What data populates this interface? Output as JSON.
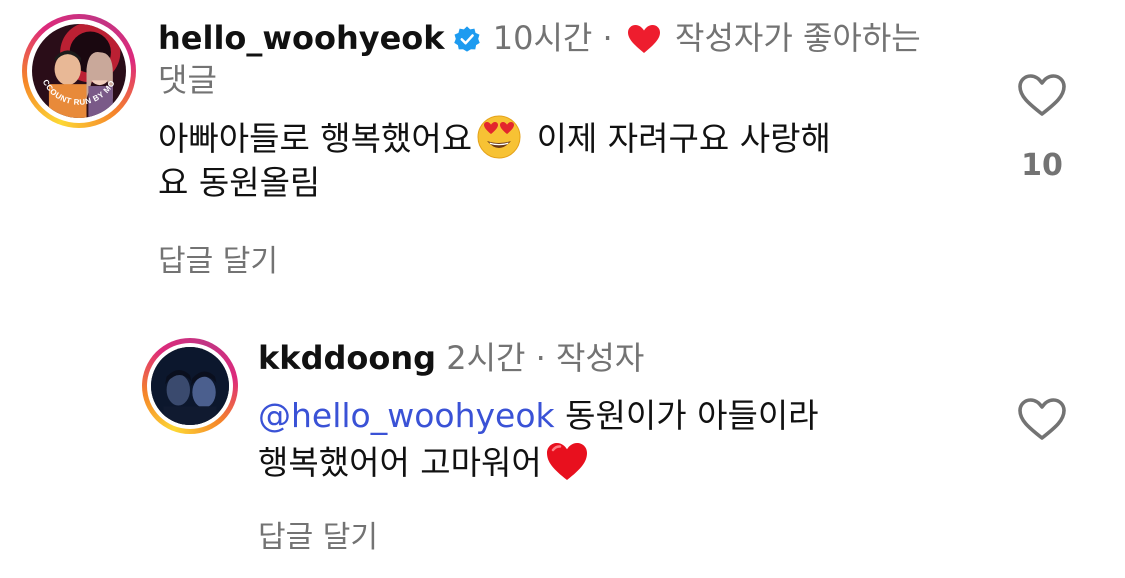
{
  "comments": [
    {
      "username": "hello_woohyeok",
      "verified": true,
      "time": "10시간",
      "separator": "·",
      "author_liked_label": "작성자가 좋아하는",
      "author_liked_label_line2": "댓글",
      "text_line1_a": "아빠아들로 행복했어요",
      "emoji": "heart-eyes-emoji",
      "text_line1_b": "이제 자려구요 사랑해",
      "text_line2": "요 동원올림",
      "reply_label": "답글 달기",
      "like_count": "10",
      "avatar_text": "ACCOUNT RUN BY MOM"
    },
    {
      "username": "kkddoong",
      "time": "2시간",
      "separator": "·",
      "author_badge": "작성자",
      "mention": "@hello_woohyeok",
      "text_line1": "동원이가 아들이라",
      "text_line2": "행복했어어 고마워어",
      "emoji": "red-heart-emoji",
      "reply_label": "답글 달기"
    }
  ],
  "colors": {
    "text": "#111111",
    "meta": "#737373",
    "mention": "#3a52d6",
    "verified": "#1d9bf0",
    "heart": "#ee1d2e"
  }
}
